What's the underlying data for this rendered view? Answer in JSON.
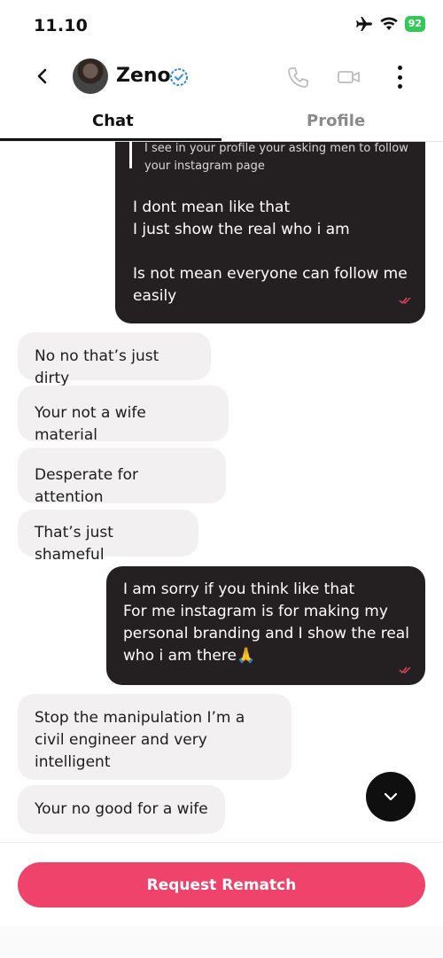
{
  "status_bar": {
    "time": "11.10",
    "battery": "92",
    "icons": [
      "airplane-icon",
      "wifi-icon",
      "battery-icon"
    ]
  },
  "header": {
    "contact_name": "Zeno",
    "verified": true,
    "icons": [
      "back-icon",
      "phone-icon",
      "video-icon",
      "more-icon"
    ]
  },
  "tabs": [
    {
      "label": "Chat",
      "active": true
    },
    {
      "label": "Profile",
      "active": false
    }
  ],
  "messages": [
    {
      "direction": "outgoing",
      "quote": "I see in your profile your asking men to follow your instagram page",
      "text": "I dont mean like that\nI just show the real who i am\n\nIs not mean everyone can follow me easily",
      "status": "read"
    },
    {
      "direction": "incoming",
      "text": "No no that’s just dirty"
    },
    {
      "direction": "incoming",
      "text": "Your not a wife material"
    },
    {
      "direction": "incoming",
      "text": "Desperate for attention"
    },
    {
      "direction": "incoming",
      "text": "That’s just shameful"
    },
    {
      "direction": "outgoing",
      "text": "I am sorry if you think like that\nFor me instagram is for making my personal branding and I show the real who i am there🙏",
      "status": "read"
    },
    {
      "direction": "incoming",
      "text": "Stop the manipulation I’m a civil engineer and very intelligent"
    },
    {
      "direction": "incoming",
      "text": "Your no good for a wife"
    }
  ],
  "actions": {
    "request_rematch_label": "Request Rematch"
  },
  "colors": {
    "accent": "#f0436b",
    "outgoing_bubble": "#242021",
    "incoming_bubble": "#f2f0f1",
    "verified_badge": "#2b8ce0"
  }
}
